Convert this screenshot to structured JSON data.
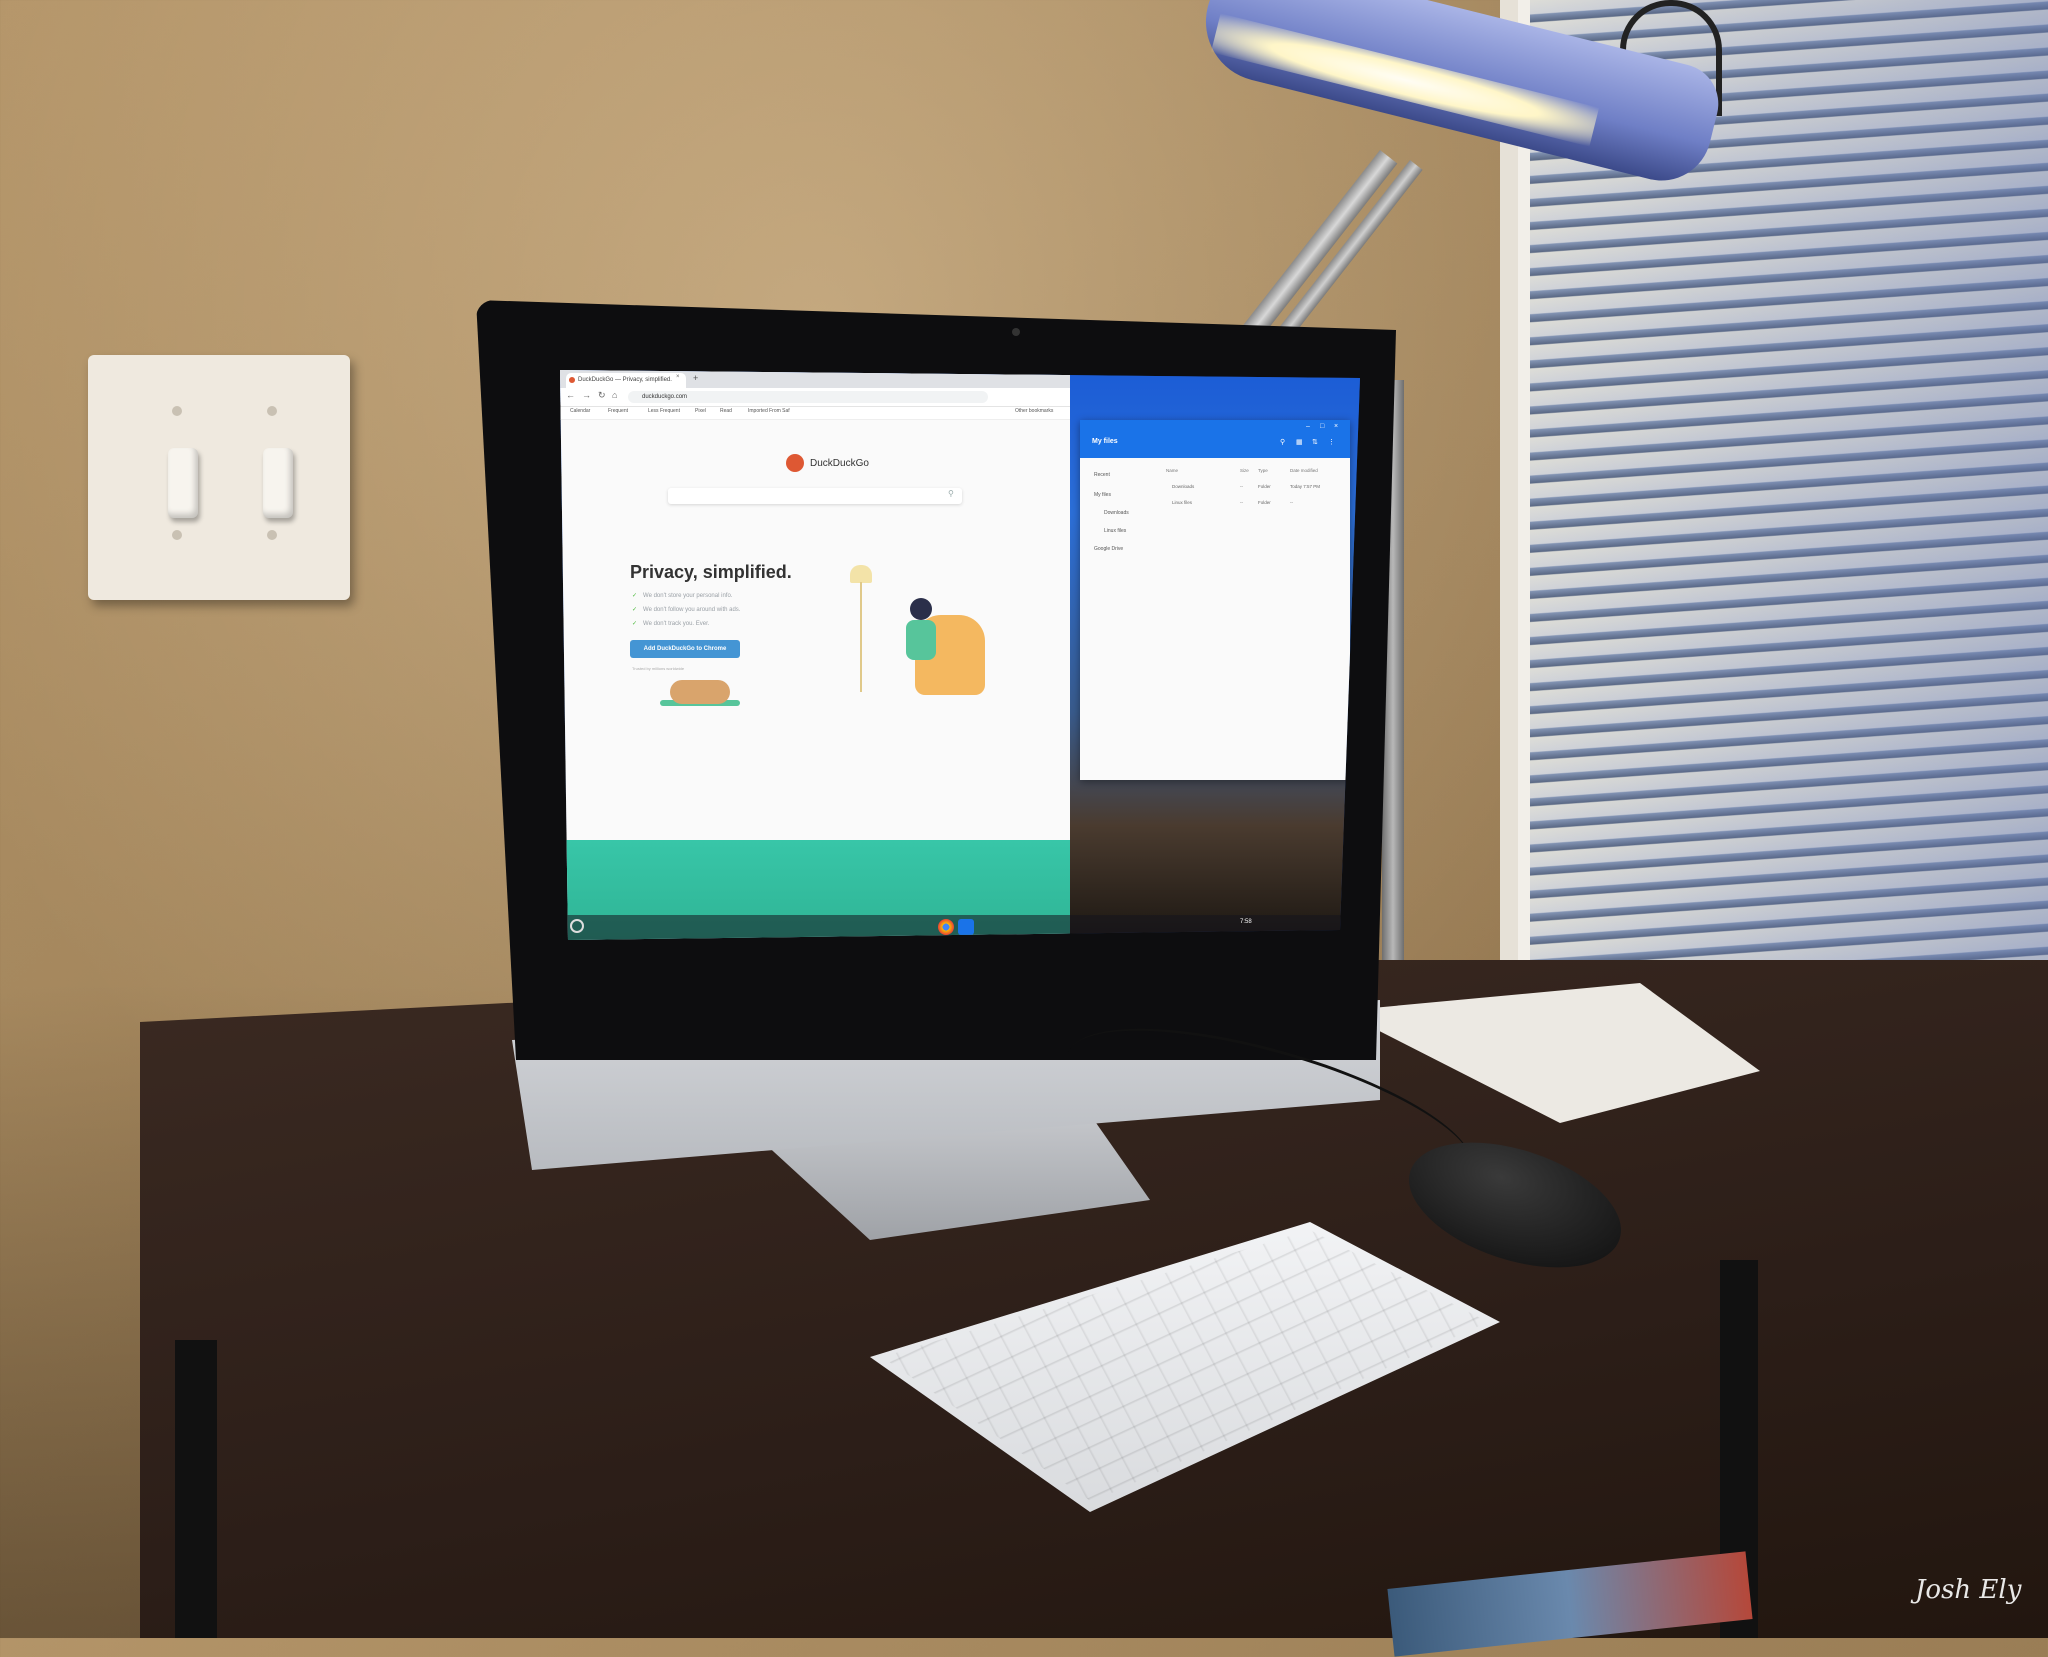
{
  "scene": "desk",
  "browser": {
    "tab_title": "DuckDuckGo — Privacy, simplified.",
    "tab_close": "×",
    "new_tab": "+",
    "address": "duckduckgo.com",
    "bookmarks": [
      "Calendar",
      "Frequent",
      "Less Frequent",
      "Pixel",
      "Read",
      "Imported From Saf",
      "Other bookmarks"
    ],
    "page": {
      "brand": "DuckDuckGo",
      "headline": "Privacy, simplified.",
      "bullets": [
        "We don't store your personal info.",
        "We don't follow you around with ads.",
        "We don't track you. Ever."
      ],
      "cta_label": "Add DuckDuckGo to Chrome",
      "powered_by": "Trusted by millions worldwide"
    }
  },
  "files_app": {
    "title": "My files",
    "nav": [
      "Recent",
      "My files",
      "Downloads",
      "Linux files",
      "Google Drive"
    ],
    "columns": [
      "Name",
      "Size",
      "Type",
      "Date modified"
    ],
    "rows": [
      {
        "name": "Downloads",
        "size": "--",
        "type": "Folder",
        "modified": "Today 7:57 PM"
      },
      {
        "name": "Linux files",
        "size": "--",
        "type": "Folder",
        "modified": "--"
      }
    ]
  },
  "shelf": {
    "time": "7:58"
  },
  "colors": {
    "ddg_orange": "#de5833",
    "cta_blue": "#4495d4",
    "teal": "#38c6a8",
    "files_blue": "#1a73e8"
  },
  "icons": [
    "apple-logo-icon",
    "search-icon",
    "launcher-icon",
    "chrome-icon",
    "files-icon"
  ],
  "signature": "Josh Ely"
}
